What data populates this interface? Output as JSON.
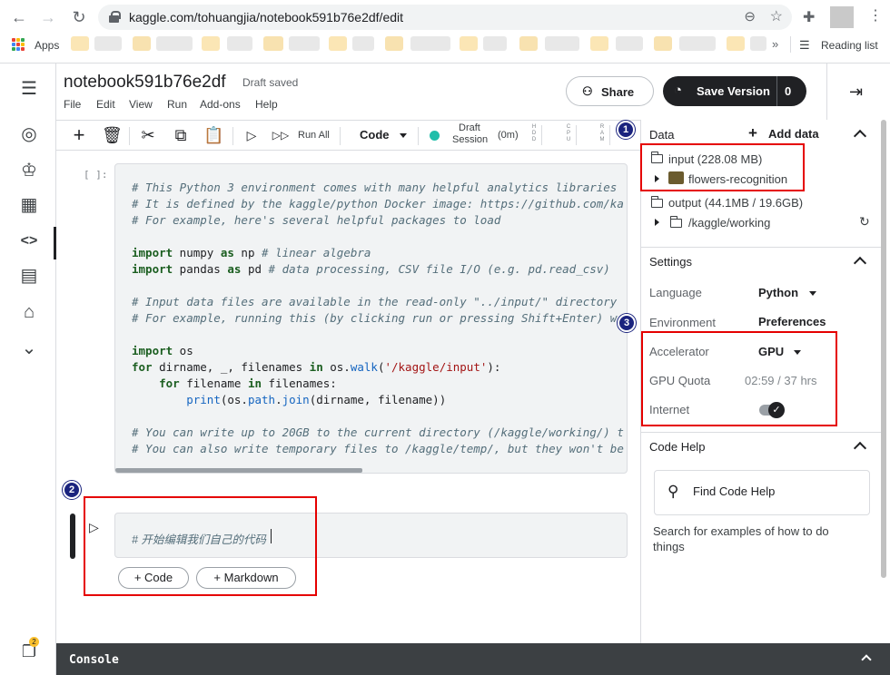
{
  "browser": {
    "url": "kaggle.com/tohuangjia/notebook591b76e2df/edit",
    "apps_label": "Apps",
    "reading_list_label": "Reading list",
    "more_bookmarks": "»"
  },
  "header": {
    "title": "notebook591b76e2df",
    "status": "Draft saved",
    "menu": [
      "File",
      "Edit",
      "View",
      "Run",
      "Add-ons",
      "Help"
    ],
    "share_label": "Share",
    "save_version_label": "Save Version",
    "version_count": "0"
  },
  "toolbar": {
    "run_all_label": "Run All",
    "cell_type": "Code",
    "session_line1": "Draft",
    "session_line2": "Session",
    "session_time": "(0m)",
    "status_color": "#20BEAA",
    "meters": [
      "HDD",
      "CPU",
      "RAM"
    ]
  },
  "cells": {
    "prompt": "[ ]:",
    "code_lines": [
      "# This Python 3 environment comes with many helpful analytics libraries",
      "# It is defined by the kaggle/python Docker image: https://github.com/ka",
      "# For example, here's several helpful packages to load",
      "",
      "import numpy as np # linear algebra",
      "import pandas as pd # data processing, CSV file I/O (e.g. pd.read_csv)",
      "",
      "# Input data files are available in the read-only \"../input/\" directory",
      "# For example, running this (by clicking run or pressing Shift+Enter) w",
      "",
      "import os",
      "for dirname, _, filenames in os.walk('/kaggle/input'):",
      "    for filename in filenames:",
      "        print(os.path.join(dirname, filename))",
      "",
      "# You can write up to 20GB to the current directory (/kaggle/working/) t",
      "# You can also write temporary files to /kaggle/temp/, but they won't be"
    ],
    "edit_text": "# 开始编辑我们自己的代码",
    "add_code_label": "+ Code",
    "add_markdown_label": "+ Markdown"
  },
  "right_panel": {
    "data_title": "Data",
    "add_data_label": "Add data",
    "input_label": "input (228.08 MB)",
    "dataset_name": "flowers-recognition",
    "output_label": "output (44.1MB / 19.6GB)",
    "working_dir": "/kaggle/working",
    "settings_title": "Settings",
    "language_label": "Language",
    "language_value": "Python",
    "environment_label": "Environment",
    "environment_value": "Preferences",
    "accelerator_label": "Accelerator",
    "accelerator_value": "GPU",
    "gpu_quota_label": "GPU Quota",
    "gpu_quota_value": "02:59 / 37 hrs",
    "internet_label": "Internet",
    "internet_on": true,
    "code_help_title": "Code Help",
    "find_code_help_label": "Find Code Help",
    "code_help_desc": "Search for examples of how to do things"
  },
  "console": {
    "label": "Console"
  },
  "left_nav": {
    "notification_count": "2"
  },
  "annotations": [
    "1",
    "2",
    "3"
  ],
  "colors": {
    "annotation_red": "#E50000",
    "badge_blue": "#1A237E",
    "dark_button": "#202124"
  }
}
